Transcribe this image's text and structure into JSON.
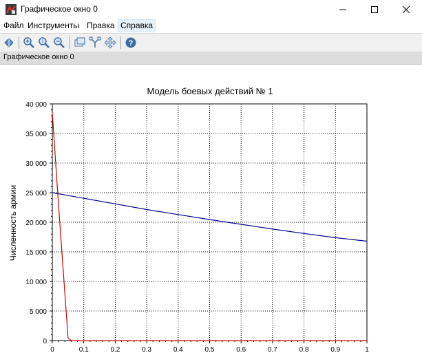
{
  "window": {
    "title": "Графическое окно 0",
    "icon": "scilab-graphics-icon"
  },
  "menu": {
    "items": [
      {
        "label": "Файл",
        "underline": "Ф"
      },
      {
        "label": "Инструменты",
        "underline": "И"
      },
      {
        "label": "Правка",
        "underline": "П"
      },
      {
        "label": "Справка",
        "underline": "С"
      }
    ]
  },
  "toolbar": {
    "icons": [
      "rotate-icon",
      "zoom-in-icon",
      "zoom-original-icon",
      "zoom-out-icon",
      "datatip-icon",
      "edit-icon",
      "pan-icon",
      "help-icon"
    ]
  },
  "status": {
    "text": "Графическое окно 0"
  },
  "colors": {
    "series_army_x": "#00008b",
    "series_army_y": "#cc0000"
  },
  "chart_data": {
    "type": "line",
    "title": "Модель боевых действий № 1",
    "xlabel": "",
    "ylabel": "Численность армии",
    "xlim": [
      0,
      1
    ],
    "ylim": [
      0,
      40000
    ],
    "xticks": [
      "0",
      "0.1",
      "0.2",
      "0.3",
      "0.4",
      "0.5",
      "0.6",
      "0.7",
      "0.8",
      "0.9",
      "1"
    ],
    "yticks": [
      "0",
      "5 000",
      "10 000",
      "15 000",
      "20 000",
      "25 000",
      "30 000",
      "35 000",
      "40 000"
    ],
    "grid": true,
    "series": [
      {
        "color": "#00008b",
        "x": [
          0,
          0.1,
          0.2,
          0.3,
          0.4,
          0.5,
          0.6,
          0.7,
          0.8,
          0.9,
          1
        ],
        "y": [
          25000,
          24050,
          23100,
          22150,
          21300,
          20450,
          19650,
          18850,
          18100,
          17400,
          16800
        ]
      },
      {
        "color": "#cc0000",
        "x": [
          0,
          0.01,
          0.02,
          0.03,
          0.04,
          0.05,
          0.06,
          0.1,
          0.2,
          0.3,
          0.4,
          0.5,
          0.6,
          0.7,
          0.8,
          0.9,
          1
        ],
        "y": [
          38500,
          30500,
          22800,
          15300,
          7900,
          500,
          0,
          0,
          0,
          0,
          0,
          0,
          0,
          0,
          0,
          0,
          0
        ]
      }
    ]
  }
}
